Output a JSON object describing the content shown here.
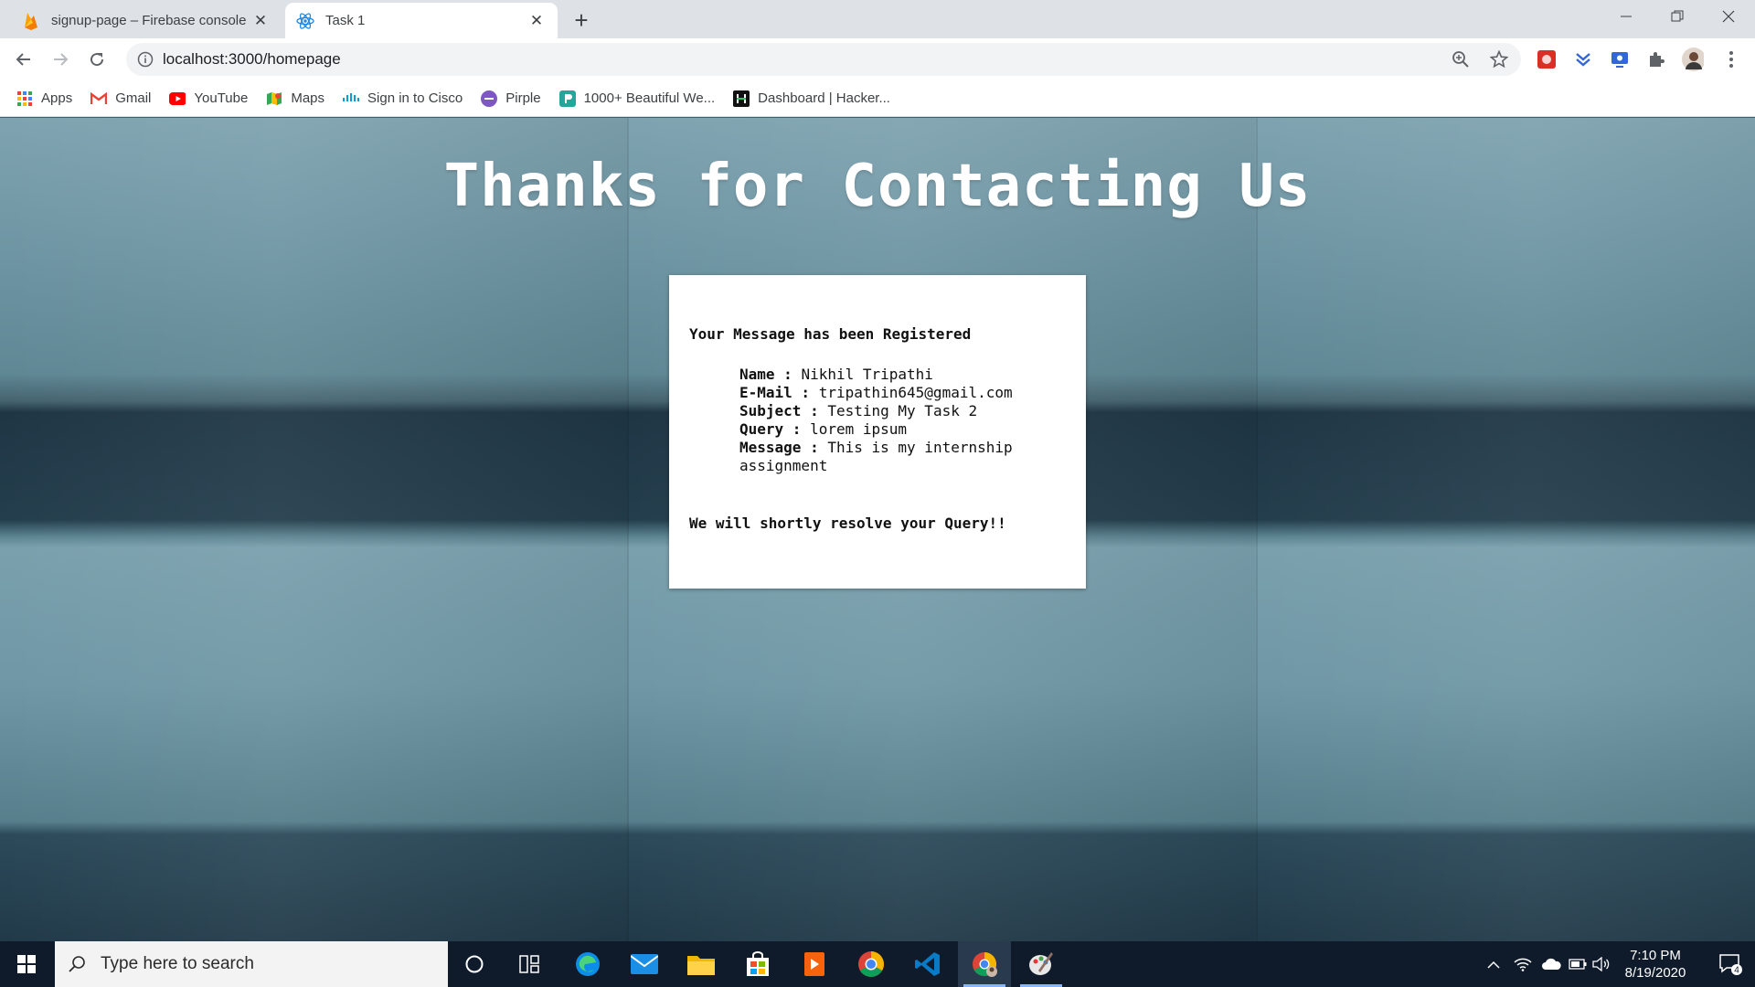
{
  "browser": {
    "tabs": [
      {
        "title": "signup-page – Firebase console",
        "active": false
      },
      {
        "title": "Task 1",
        "active": true
      }
    ],
    "url": "localhost:3000/homepage",
    "bookmarks": [
      {
        "label": "Apps",
        "icon": "apps-grid-icon"
      },
      {
        "label": "Gmail",
        "icon": "gmail-icon"
      },
      {
        "label": "YouTube",
        "icon": "youtube-icon"
      },
      {
        "label": "Maps",
        "icon": "maps-icon"
      },
      {
        "label": "Sign in to Cisco",
        "icon": "cisco-icon"
      },
      {
        "label": "Pirple",
        "icon": "pirple-icon"
      },
      {
        "label": "1000+ Beautiful We...",
        "icon": "bookmark-page-icon"
      },
      {
        "label": "Dashboard | Hacker...",
        "icon": "hackerrank-icon"
      }
    ]
  },
  "page": {
    "heading": "Thanks for Contacting Us",
    "card": {
      "registered": "Your Message has been Registered",
      "fields": [
        {
          "label": "Name :",
          "value": "Nikhil Tripathi"
        },
        {
          "label": "E-Mail :",
          "value": "tripathin645@gmail.com"
        },
        {
          "label": "Subject :",
          "value": "Testing My Task 2"
        },
        {
          "label": "Query :",
          "value": "lorem ipsum"
        },
        {
          "label": "Message :",
          "value": "This is my internship assignment"
        }
      ],
      "footer": "We will shortly resolve your Query!!"
    }
  },
  "taskbar": {
    "search_placeholder": "Type here to search",
    "time": "7:10 PM",
    "date": "8/19/2020",
    "notification_count": "4"
  },
  "colors": {
    "taskbar": "#0f1b2b",
    "tab_strip": "#dee1e6",
    "card": "#ffffff",
    "accent": "#8ab4f8"
  }
}
